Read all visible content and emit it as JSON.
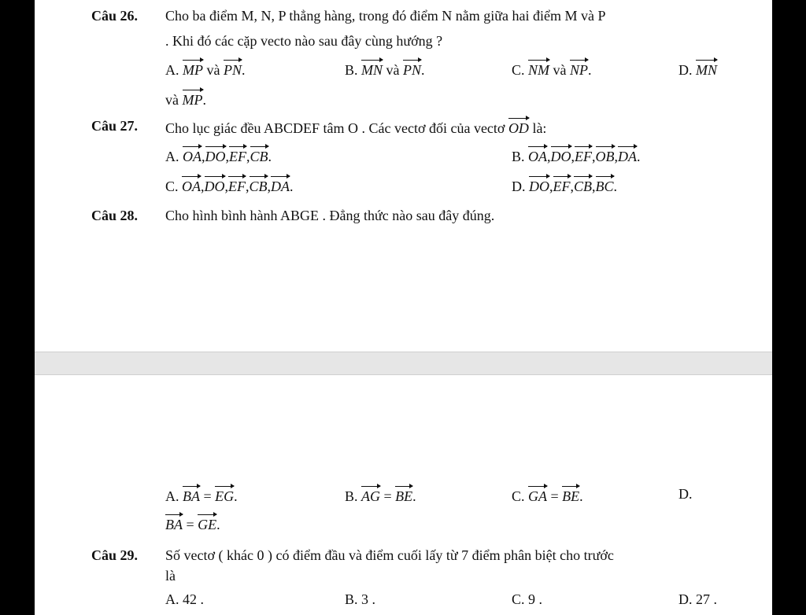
{
  "q26": {
    "num": "Câu 26.",
    "text_line1": "Cho ba điểm M, N, P thẳng hàng, trong đó điểm N nằm giữa hai điểm M và P",
    "text_line2": ". Khi đó các cặp vecto nào sau đây cùng hướng ?",
    "options": [
      {
        "label": "A.",
        "v1": "MP",
        "mid": "và",
        "v2": "PN",
        "end": "."
      },
      {
        "label": "B.",
        "v1": "MN",
        "mid": "và",
        "v2": "PN",
        "end": "."
      },
      {
        "label": "C.",
        "v1": "NM",
        "mid": "và",
        "v2": "NP",
        "end": "."
      },
      {
        "label": "D.",
        "v1": "MN",
        "mid": "",
        "v2": "",
        "end": ""
      }
    ],
    "cont_prefix": "và",
    "cont_vec": "MP",
    "cont_end": "."
  },
  "q27": {
    "num": "Câu 27.",
    "text": "Cho lục giác đều ABCDEF tâm O . Các vectơ đối của vectơ",
    "text_vec": "OD",
    "text_end": "là:",
    "options": [
      {
        "label": "A.",
        "vecs": [
          "OA",
          "DO",
          "EF",
          "CB"
        ],
        "end": "."
      },
      {
        "label": "B.",
        "vecs": [
          "OA",
          "DO",
          "EF",
          "OB",
          "DA"
        ],
        "end": "."
      },
      {
        "label": "C.",
        "vecs": [
          "OA",
          "DO",
          "EF",
          "CB",
          "DA"
        ],
        "end": "."
      },
      {
        "label": "D.",
        "vecs": [
          "DO",
          "EF",
          "CB",
          "BC"
        ],
        "end": "."
      }
    ]
  },
  "q28": {
    "num": "Câu 28.",
    "text": "Cho hình bình hành ABGE . Đẳng thức nào sau đây đúng.",
    "options": [
      {
        "label": "A.",
        "l": "BA",
        "r": "EG",
        "end": "."
      },
      {
        "label": "B.",
        "l": "AG",
        "r": "BE",
        "end": "."
      },
      {
        "label": "C.",
        "l": "GA",
        "r": "BE",
        "end": "."
      },
      {
        "label": "D.",
        "l": "",
        "r": "",
        "end": ""
      }
    ],
    "cont": {
      "l": "BA",
      "r": "GE",
      "end": "."
    }
  },
  "q29": {
    "num": "Câu 29.",
    "text_line1": "Số vectơ ( khác 0 ) có điểm đầu và điểm cuối lấy từ 7 điểm phân biệt cho trước",
    "text_line2": "là",
    "options": [
      {
        "label": "A.",
        "value": "42 ."
      },
      {
        "label": "B.",
        "value": "3 ."
      },
      {
        "label": "C.",
        "value": "9 ."
      },
      {
        "label": "D.",
        "value": "27 ."
      }
    ]
  }
}
